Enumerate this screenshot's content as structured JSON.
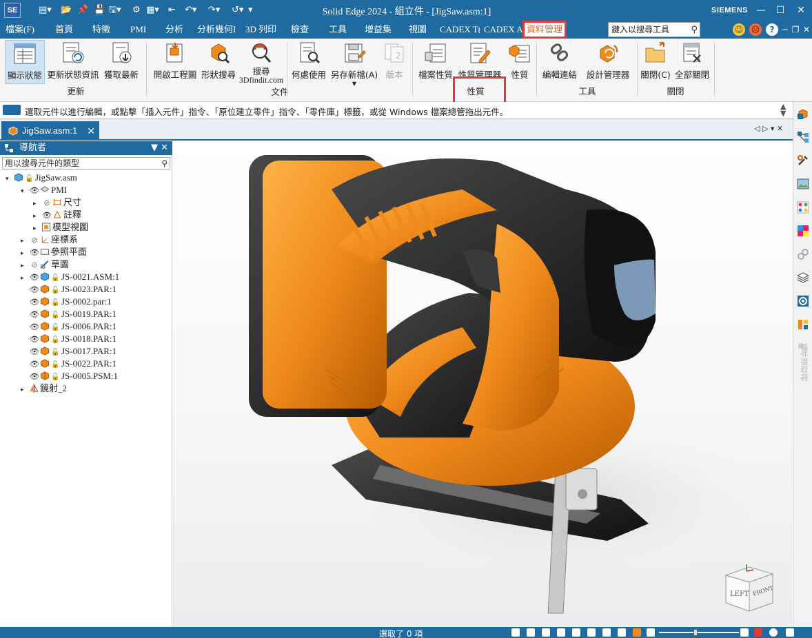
{
  "titlebar": {
    "logo": "SE",
    "title": "Solid Edge 2024 - 組立件 - [JigSaw.asm:1]",
    "brand": "SIEMENS",
    "minimize": "—",
    "maximize": "☐",
    "close": "✕"
  },
  "menu": {
    "tabs": [
      {
        "label": "檔案(F)"
      },
      {
        "label": "首頁"
      },
      {
        "label": "特徵"
      },
      {
        "label": "PMI"
      },
      {
        "label": "分析"
      },
      {
        "label": "分析幾何I"
      },
      {
        "label": "3D 列印"
      },
      {
        "label": "檢查"
      },
      {
        "label": "工具"
      },
      {
        "label": "增益集"
      },
      {
        "label": "視圖"
      },
      {
        "label": "CADEX T("
      },
      {
        "label": "CADEX A"
      },
      {
        "label": "資料管理"
      }
    ],
    "search_placeholder": "鍵入以搜尋工具"
  },
  "ribbon": {
    "buttons": [
      {
        "label": "顯示狀態"
      },
      {
        "label": "更新狀態資訊"
      },
      {
        "label": "獲取最新"
      },
      {
        "label": "開啟工程圖"
      },
      {
        "label": "形狀搜尋"
      },
      {
        "label": "搜尋"
      },
      {
        "sublabel": "3Dfindit.com"
      },
      {
        "label": "何處使用"
      },
      {
        "label": "另存新檔(A)"
      },
      {
        "label": "版本"
      },
      {
        "label": "檔案性質"
      },
      {
        "label": "性質管理器"
      },
      {
        "label": "性質"
      },
      {
        "label": "編輯連結"
      },
      {
        "label": "設計管理器"
      },
      {
        "label": "關閉(C)"
      },
      {
        "label": "全部關閉"
      }
    ],
    "groups": {
      "update": "更新",
      "document": "文件",
      "properties": "性質",
      "tools": "工具",
      "close": "關閉"
    }
  },
  "prompt": {
    "text": "選取元件以進行編輯，或點擊「插入元件」指令、「原位建立零件」指令、「零件庫」標籤，或從 Windows 檔案總管拖出元件。"
  },
  "doc_tab": {
    "label": "JigSaw.asm:1",
    "close": "✕"
  },
  "navigator": {
    "title": "導航者",
    "search_placeholder": "用以搜尋元件的類型",
    "tree": [
      {
        "label": "JigSaw.asm"
      },
      {
        "label": "PMI"
      },
      {
        "label": "尺寸"
      },
      {
        "label": "註釋"
      },
      {
        "label": "模型視圖"
      },
      {
        "label": "座標系"
      },
      {
        "label": "參照平面"
      },
      {
        "label": "草圖"
      },
      {
        "label": "JS-0021.ASM:1"
      },
      {
        "label": "JS-0023.PAR:1"
      },
      {
        "label": "JS-0002.par:1"
      },
      {
        "label": "JS-0019.PAR:1"
      },
      {
        "label": "JS-0006.PAR:1"
      },
      {
        "label": "JS-0018.PAR:1"
      },
      {
        "label": "JS-0017.PAR:1"
      },
      {
        "label": "JS-0022.PAR:1"
      },
      {
        "label": "JS-0005.PSM:1"
      },
      {
        "label": "鏡射_2"
      }
    ]
  },
  "viewcube": {
    "left": "LEFT",
    "front": "FRONT"
  },
  "right_panel_text": "條件選取器",
  "status": {
    "text": "選取了 0 項"
  },
  "colors": {
    "accent": "#1f6aa0",
    "highlight": "#e53935",
    "orange": "#f08a1c"
  }
}
